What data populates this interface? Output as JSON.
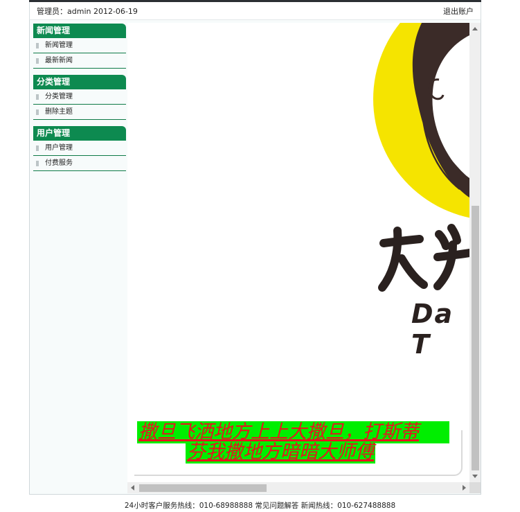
{
  "header": {
    "admin_text": "管理员：admin 2012-06-19",
    "logout_label": "退出账户"
  },
  "sidebar": {
    "groups": [
      {
        "title": "新闻管理",
        "items": [
          {
            "label": "新闻管理"
          },
          {
            "label": "最新新闻"
          }
        ]
      },
      {
        "title": "分类管理",
        "items": [
          {
            "label": "分类管理"
          },
          {
            "label": "删除主题"
          }
        ]
      },
      {
        "title": "用户管理",
        "items": [
          {
            "label": "用户管理"
          },
          {
            "label": "付费服务"
          }
        ]
      }
    ]
  },
  "main": {
    "logo_text_cn": "大头",
    "logo_text_en": "Da T",
    "marquee_line1": "撒旦飞洒地方上上大撒旦，打斯蒂",
    "marquee_line2": "芬我撒地方暗暗大师傅"
  },
  "footer": {
    "text": "24小时客户服务热线：010-68988888 常见问题解答 新闻热线：010-627488888"
  },
  "colors": {
    "accent": "#0d8a50",
    "marquee_bg": "#00ee00",
    "marquee_text": "#e8141e",
    "logo_yellow": "#f5e400"
  },
  "icons": [
    "grip-icon",
    "arrow-up-icon",
    "arrow-down-icon",
    "arrow-left-icon",
    "arrow-right-icon"
  ]
}
